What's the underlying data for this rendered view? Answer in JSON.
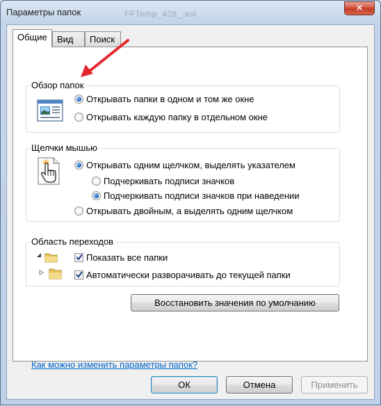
{
  "window": {
    "title": "Параметры папок",
    "background_title": "FFTemp_428_.avi"
  },
  "tabs": [
    {
      "label": "Общие",
      "active": true
    },
    {
      "label": "Вид",
      "active": false
    },
    {
      "label": "Поиск",
      "active": false
    }
  ],
  "browse_group": {
    "label": "Обзор папок",
    "options": [
      {
        "label": "Открывать папки в одном и том же окне",
        "selected": true
      },
      {
        "label": "Открывать каждую папку в отдельном окне",
        "selected": false
      }
    ]
  },
  "clicks_group": {
    "label": "Щелчки мышью",
    "single_click": {
      "label": "Открывать одним щелчком, выделять указателем",
      "selected": true
    },
    "sub_options": [
      {
        "label": "Подчеркивать подписи значков",
        "selected": false
      },
      {
        "label": "Подчеркивать подписи значков при наведении",
        "selected": true
      }
    ],
    "double_click": {
      "label": "Открывать двойным, а выделять одним щелчком",
      "selected": false
    }
  },
  "nav_group": {
    "label": "Область переходов",
    "options": [
      {
        "label": "Показать все папки",
        "checked": true
      },
      {
        "label": "Автоматически разворачивать до текущей папки",
        "checked": true
      }
    ]
  },
  "restore_button": "Восстановить значения по умолчанию",
  "help_link": "Как можно изменить параметры папок?",
  "footer": {
    "ok": "ОК",
    "cancel": "Отмена",
    "apply": "Применить"
  },
  "colors": {
    "annotation_arrow": "#e3262b",
    "link": "#0066cc",
    "close_button": "#c43b22"
  }
}
